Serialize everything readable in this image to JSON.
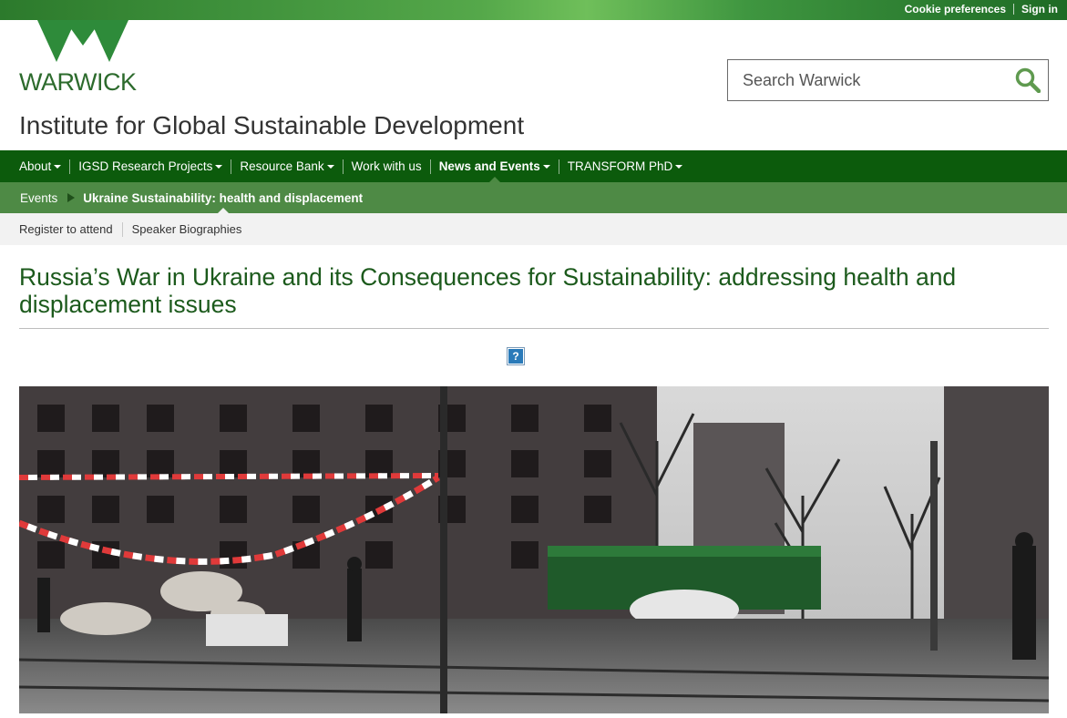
{
  "topbar": {
    "links": [
      "Cookie preferences",
      "Sign in"
    ]
  },
  "brand": {
    "wordmark": "WARWICK",
    "site_title": "Institute for Global Sustainable Development",
    "color": "#2d6b2d"
  },
  "search": {
    "placeholder": "Search Warwick",
    "icon": "search-icon"
  },
  "main_nav": {
    "items": [
      {
        "label": "About",
        "dropdown": true
      },
      {
        "label": "IGSD Research Projects",
        "dropdown": true
      },
      {
        "label": "Resource Bank",
        "dropdown": true
      },
      {
        "label": "Work with us",
        "dropdown": false
      },
      {
        "label": "News and Events",
        "dropdown": true,
        "active": true
      },
      {
        "label": "TRANSFORM PhD",
        "dropdown": true
      }
    ],
    "background": "#0c5b0c"
  },
  "breadcrumb": {
    "items": [
      "Events",
      "Ukraine Sustainability: health and displacement"
    ],
    "background": "#4e8a45"
  },
  "sub_nav": {
    "items": [
      "Register to attend",
      "Speaker Biographies"
    ]
  },
  "page": {
    "title": "Russia’s War in Ukraine and its Consequences for Sustainability: addressing health and displacement issues",
    "broken_image_glyph": "?"
  }
}
